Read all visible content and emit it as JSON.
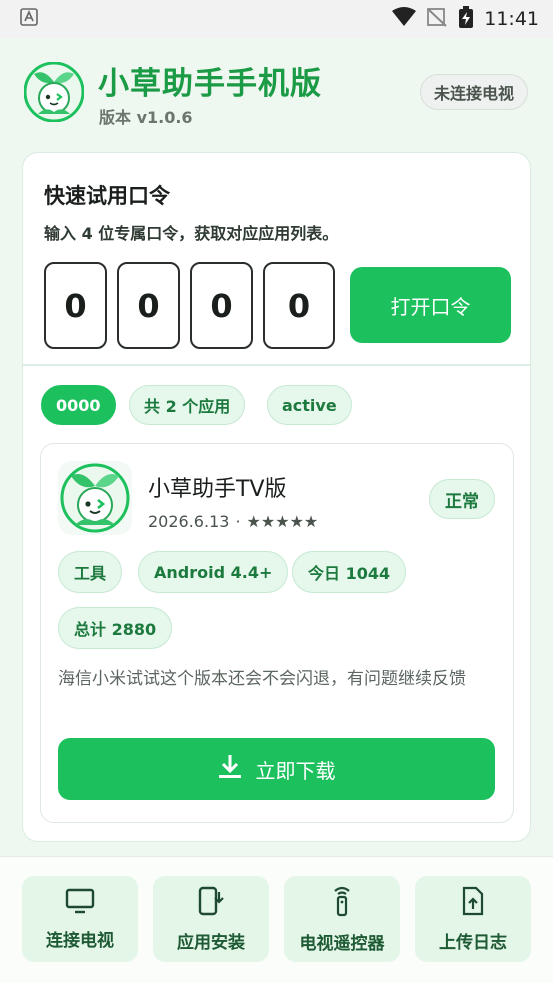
{
  "status_bar": {
    "time": "11:41"
  },
  "header": {
    "title": "小草助手手机版",
    "version": "版本 v1.0.6",
    "connection_status": "未连接电视"
  },
  "code_section": {
    "title": "快速试用口令",
    "description": "输入 4 位专属口令，获取对应应用列表。",
    "digits": [
      "0",
      "0",
      "0",
      "0"
    ],
    "open_label": "打开口令"
  },
  "result_chips": {
    "code": "0000",
    "count": "共 2 个应用",
    "state": "active"
  },
  "app": {
    "name": "小草助手TV版",
    "date": "2026.6.13",
    "separator": "·",
    "stars": "★★★★★",
    "status": "正常",
    "tags": [
      "工具",
      "Android 4.4+",
      "今日 1044",
      "总计 2880"
    ],
    "description": "海信小米试试这个版本还会不会闪退，有问题继续反馈",
    "download_label": "立即下载"
  },
  "bottom_nav": [
    {
      "label": "连接电视",
      "icon": "tv-icon"
    },
    {
      "label": "应用安装",
      "icon": "install-icon"
    },
    {
      "label": "电视遥控器",
      "icon": "remote-icon"
    },
    {
      "label": "上传日志",
      "icon": "upload-file-icon"
    }
  ],
  "colors": {
    "brand_green": "#1cc15e",
    "title_green": "#1c9b46",
    "chip_bg": "#e6f7ec"
  }
}
